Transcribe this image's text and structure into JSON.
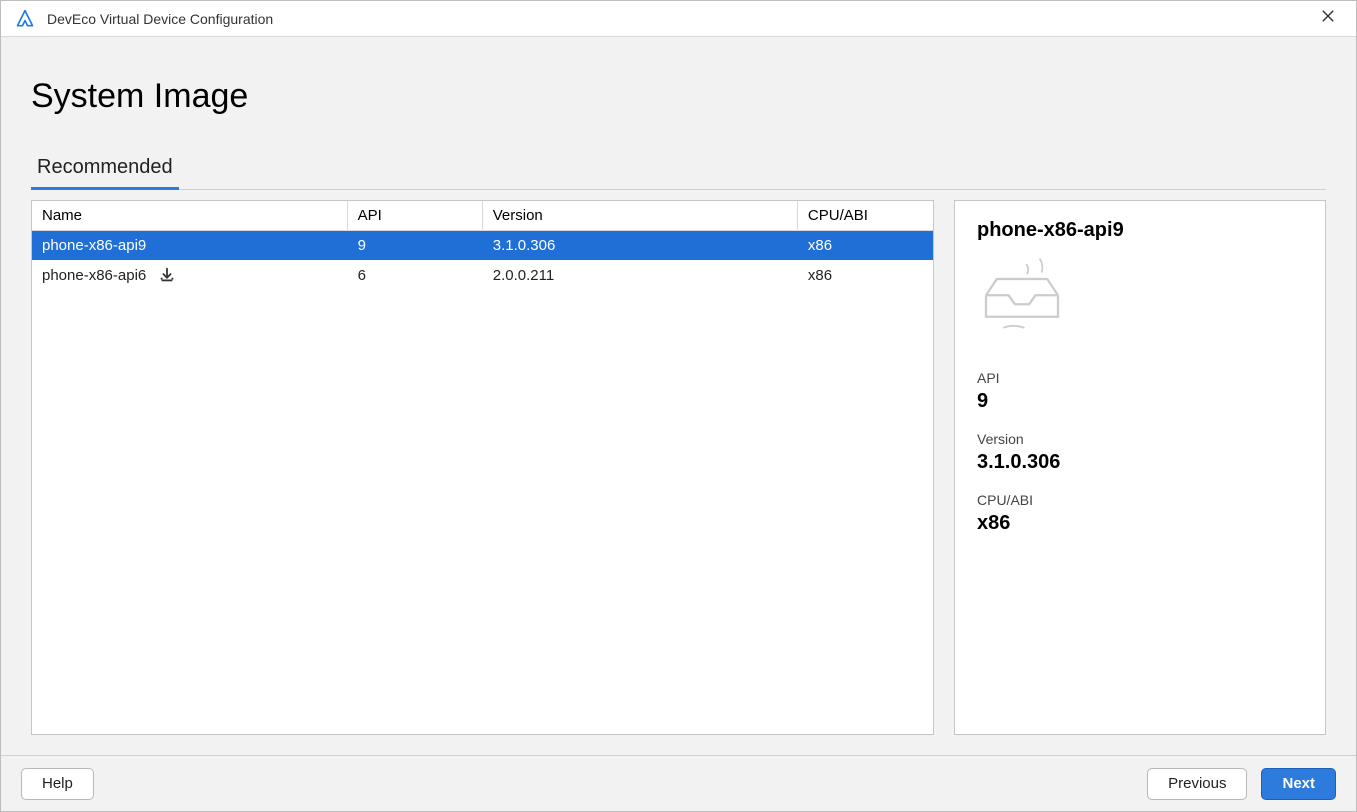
{
  "window": {
    "title": "DevEco Virtual Device Configuration"
  },
  "page": {
    "title": "System Image"
  },
  "tabs": {
    "recommended": "Recommended"
  },
  "table": {
    "headers": {
      "name": "Name",
      "api": "API",
      "version": "Version",
      "abi": "CPU/ABI"
    },
    "rows": [
      {
        "name": "phone-x86-api9",
        "api": "9",
        "version": "3.1.0.306",
        "abi": "x86",
        "selected": true,
        "downloadable": false
      },
      {
        "name": "phone-x86-api6",
        "api": "6",
        "version": "2.0.0.211",
        "abi": "x86",
        "selected": false,
        "downloadable": true
      }
    ]
  },
  "detail": {
    "title": "phone-x86-api9",
    "api_label": "API",
    "api_value": "9",
    "version_label": "Version",
    "version_value": "3.1.0.306",
    "abi_label": "CPU/ABI",
    "abi_value": "x86"
  },
  "footer": {
    "help": "Help",
    "previous": "Previous",
    "next": "Next"
  }
}
